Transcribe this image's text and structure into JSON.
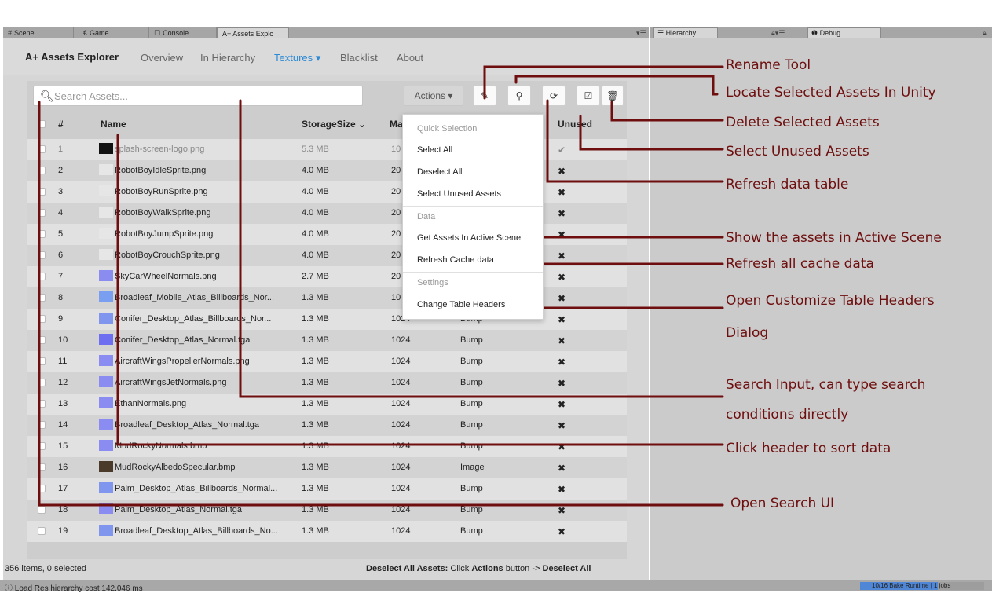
{
  "tabs": [
    {
      "icon": "#",
      "label": "Scene"
    },
    {
      "icon": "€",
      "label": "Game"
    },
    {
      "icon": "☐",
      "label": "Console"
    },
    {
      "icon": "",
      "label": "A+ Assets Explc"
    }
  ],
  "right_tabs": [
    {
      "icon": "☰",
      "label": "Hierarchy"
    },
    {
      "icon": "❶",
      "label": "Debug"
    }
  ],
  "app": {
    "title": "A+ Assets Explorer",
    "nav": [
      "Overview",
      "In Hierarchy",
      "Textures ▾",
      "Blacklist",
      "About"
    ]
  },
  "search": {
    "placeholder": "Search Assets..."
  },
  "actions_label": "Actions ▾",
  "columns": {
    "num": "#",
    "name": "Name",
    "storage": "StorageSize ⌄",
    "max": "Ma",
    "unused": "Unused"
  },
  "rows": [
    {
      "num": "1",
      "name": "splash-screen-logo.png",
      "size": "5.3 MB",
      "max": "10",
      "type": "",
      "unused": "✔"
    },
    {
      "num": "2",
      "name": "RobotBoyIdleSprite.png",
      "size": "4.0 MB",
      "max": "20",
      "type": "",
      "unused": "✖"
    },
    {
      "num": "3",
      "name": "RobotBoyRunSprite.png",
      "size": "4.0 MB",
      "max": "20",
      "type": "",
      "unused": "✖"
    },
    {
      "num": "4",
      "name": "RobotBoyWalkSprite.png",
      "size": "4.0 MB",
      "max": "20",
      "type": "",
      "unused": "✖"
    },
    {
      "num": "5",
      "name": "RobotBoyJumpSprite.png",
      "size": "4.0 MB",
      "max": "20",
      "type": "",
      "unused": "✖"
    },
    {
      "num": "6",
      "name": "RobotBoyCrouchSprite.png",
      "size": "4.0 MB",
      "max": "20",
      "type": "",
      "unused": "✖"
    },
    {
      "num": "7",
      "name": "SkyCarWheelNormals.png",
      "size": "2.7 MB",
      "max": "20",
      "type": "",
      "unused": "✖"
    },
    {
      "num": "8",
      "name": "Broadleaf_Mobile_Atlas_Billboards_Nor...",
      "size": "1.3 MB",
      "max": "10",
      "type": "",
      "unused": "✖"
    },
    {
      "num": "9",
      "name": "Conifer_Desktop_Atlas_Billboards_Nor...",
      "size": "1.3 MB",
      "max": "1024",
      "type": "Bump",
      "unused": "✖"
    },
    {
      "num": "10",
      "name": "Conifer_Desktop_Atlas_Normal.tga",
      "size": "1.3 MB",
      "max": "1024",
      "type": "Bump",
      "unused": "✖"
    },
    {
      "num": "11",
      "name": "AircraftWingsPropellerNormals.png",
      "size": "1.3 MB",
      "max": "1024",
      "type": "Bump",
      "unused": "✖"
    },
    {
      "num": "12",
      "name": "AircraftWingsJetNormals.png",
      "size": "1.3 MB",
      "max": "1024",
      "type": "Bump",
      "unused": "✖"
    },
    {
      "num": "13",
      "name": "EthanNormals.png",
      "size": "1.3 MB",
      "max": "1024",
      "type": "Bump",
      "unused": "✖"
    },
    {
      "num": "14",
      "name": "Broadleaf_Desktop_Atlas_Normal.tga",
      "size": "1.3 MB",
      "max": "1024",
      "type": "Bump",
      "unused": "✖"
    },
    {
      "num": "15",
      "name": "MudRockyNormals.bmp",
      "size": "1.3 MB",
      "max": "1024",
      "type": "Bump",
      "unused": "✖"
    },
    {
      "num": "16",
      "name": "MudRockyAlbedoSpecular.bmp",
      "size": "1.3 MB",
      "max": "1024",
      "type": "Image",
      "unused": "✖"
    },
    {
      "num": "17",
      "name": "Palm_Desktop_Atlas_Billboards_Normal...",
      "size": "1.3 MB",
      "max": "1024",
      "type": "Bump",
      "unused": "✖"
    },
    {
      "num": "18",
      "name": "Palm_Desktop_Atlas_Normal.tga",
      "size": "1.3 MB",
      "max": "1024",
      "type": "Bump",
      "unused": "✖"
    },
    {
      "num": "19",
      "name": "Broadleaf_Desktop_Atlas_Billboards_No...",
      "size": "1.3 MB",
      "max": "1024",
      "type": "Bump",
      "unused": "✖"
    }
  ],
  "thumb_colors": [
    "#111111",
    "#e6e6e6",
    "#e6e6e6",
    "#e6e6e6",
    "#e6e6e6",
    "#e6e6e6",
    "#8a8cf0",
    "#7a9ef0",
    "#7f95ee",
    "#6d6ef0",
    "#8b8cf2",
    "#8a8cf2",
    "#8a8cf2",
    "#8a8cf2",
    "#8a8cf2",
    "#4a3a2a",
    "#7f95ee",
    "#8a8cf2",
    "#7f95ee"
  ],
  "status": {
    "count": "356 items, 0 selected",
    "hint_bold": "Deselect All Assets:",
    "hint_mid": " Click ",
    "hint_bold2": "Actions",
    "hint_mid2": " button -> ",
    "hint_bold3": "Deselect All"
  },
  "dropdown": {
    "sections": [
      {
        "title": "Quick Selection",
        "items": [
          "Select All",
          "Deselect All",
          "Select Unused Assets"
        ]
      },
      {
        "title": "Data",
        "items": [
          "Get Assets In Active Scene",
          "Refresh Cache data"
        ]
      },
      {
        "title": "Settings",
        "items": [
          "Change Table Headers"
        ]
      }
    ]
  },
  "annotations": [
    "Rename Tool",
    "Locate Selected Assets In Unity",
    "Delete Selected Assets",
    "Select Unused Assets",
    "Refresh data table",
    "Show the assets in Active Scene",
    "Refresh all cache data",
    "Open Customize Table Headers",
    "Dialog",
    "Search Input, can type search",
    "conditions directly",
    "Click header to sort data",
    "Open Search UI"
  ],
  "bottom": {
    "log": "Load Res hierarchy cost 142.046 ms",
    "bake": "10/16 Bake Runtime | 1 jobs",
    "bake_progress": 0.625
  },
  "colors": {
    "accent": "#2b8ad6",
    "annotation": "#6e0e0e"
  }
}
